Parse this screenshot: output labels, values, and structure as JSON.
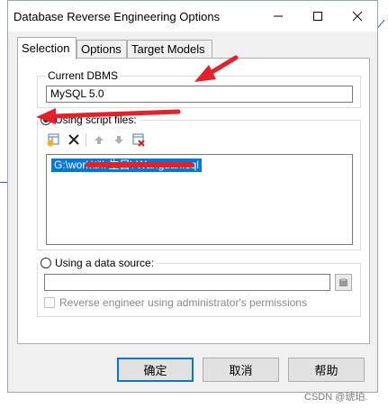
{
  "window": {
    "title": "Database Reverse Engineering Options",
    "controls": {
      "minimize_icon": "minimize-icon",
      "maximize_icon": "maximize-icon",
      "close_icon": "close-icon"
    }
  },
  "tabs": [
    {
      "label": "Selection",
      "active": true
    },
    {
      "label": "Options",
      "active": false
    },
    {
      "label": "Target Models",
      "active": false
    }
  ],
  "dbms": {
    "legend": "Current DBMS",
    "value": "MySQL 5.0"
  },
  "script_files": {
    "legend": "Using script files:",
    "selected": true,
    "toolbar": [
      "add-file-icon",
      "delete-icon",
      "move-up-icon",
      "move-down-icon",
      "clear-list-icon"
    ],
    "items": [
      "G:\\work\\ti\\\\ 生目\\ Wanguan.sql"
    ]
  },
  "data_source": {
    "legend": "Using a data source:",
    "selected": false,
    "value": "",
    "admin_checkbox_label": "Reverse engineer using administrator's permissions"
  },
  "buttons": {
    "ok": "确定",
    "cancel": "取消",
    "help": "帮助"
  },
  "watermark": "CSDN @琥珀.",
  "colors": {
    "accent": "#0078d7",
    "annotation_arrow": "#e5202a",
    "selection_bg": "#0078d7"
  }
}
